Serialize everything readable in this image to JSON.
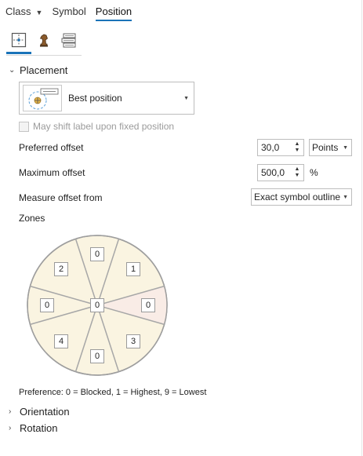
{
  "tabs": [
    {
      "label": "Class"
    },
    {
      "label": "Symbol"
    },
    {
      "label": "Position"
    }
  ],
  "icon_tabs": [
    {
      "icon": "position-crosshair-icon"
    },
    {
      "icon": "knight-chess-icon"
    },
    {
      "icon": "label-stack-icon"
    }
  ],
  "placement": {
    "title": "Placement",
    "best_position": "Best position",
    "shift_label": "May shift label upon fixed position",
    "preferred_offset_label": "Preferred offset",
    "preferred_offset_value": "30,0",
    "preferred_offset_unit": "Points",
    "maximum_offset_label": "Maximum offset",
    "maximum_offset_value": "500,0",
    "maximum_offset_unit": "%",
    "measure_from_label": "Measure offset from",
    "measure_from_value": "Exact symbol outline",
    "zones_label": "Zones",
    "zones": {
      "top": "0",
      "top_right": "1",
      "right": "0",
      "bottom_right": "3",
      "bottom": "0",
      "bottom_left": "4",
      "left": "0",
      "top_left": "2",
      "center": "0"
    },
    "preference_text": "Preference: 0 = Blocked, 1 = Highest, 9 = Lowest"
  },
  "sections": {
    "orientation": "Orientation",
    "rotation": "Rotation"
  },
  "colors": {
    "accent": "#1a73b8",
    "zone_fill": "#faf4e1",
    "zone_fill_right": "#f9ece6"
  }
}
